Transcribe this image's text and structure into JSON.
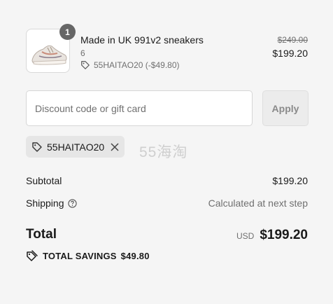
{
  "product": {
    "quantity": "1",
    "name": "Made in UK 991v2 sneakers",
    "variant": "6",
    "line_discount": "55HAITAO20 (-$49.80)",
    "compare_price": "$249.00",
    "price": "$199.20",
    "thumbnail_icon": "sneaker-image"
  },
  "discount": {
    "placeholder": "Discount code or gift card",
    "apply_label": "Apply",
    "applied_code": "55HAITAO20"
  },
  "watermark": "55海淘",
  "summary": {
    "subtotal_label": "Subtotal",
    "subtotal_value": "$199.20",
    "shipping_label": "Shipping",
    "shipping_value": "Calculated at next step",
    "total_label": "Total",
    "currency": "USD",
    "total_value": "$199.20",
    "savings_label": "TOTAL SAVINGS",
    "savings_value": "$49.80"
  },
  "colors": {
    "background": "#f5f5f5",
    "text": "#1a1a1a",
    "muted": "#707070",
    "chip": "#e6e6e6",
    "badge": "#666666"
  }
}
